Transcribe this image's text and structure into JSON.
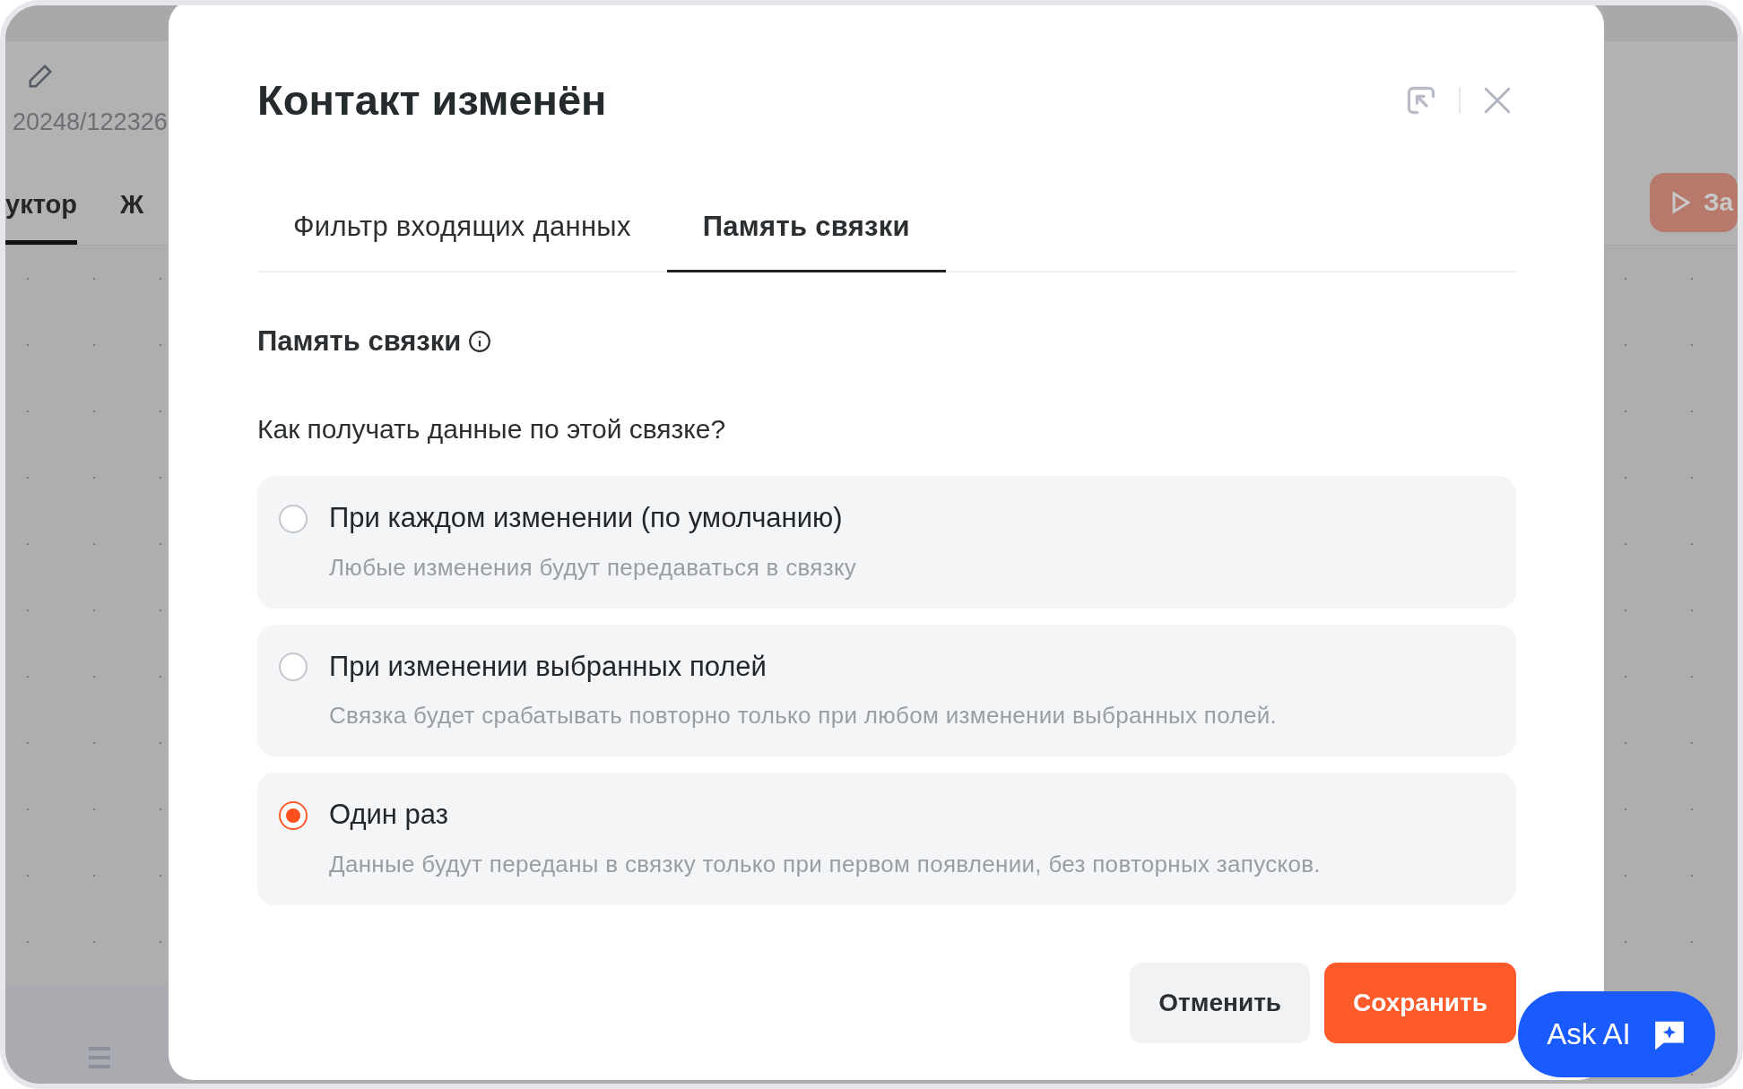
{
  "background_app": {
    "record_id": "20248/122326",
    "tabs": [
      {
        "label": "уктор",
        "selected": true
      },
      {
        "label": "Ж",
        "selected": false
      }
    ],
    "run_button": "За"
  },
  "dialog": {
    "title": "Контакт изменён",
    "tabs": [
      {
        "label": "Фильтр входящих данных",
        "selected": false
      },
      {
        "label": "Память связки",
        "selected": true
      }
    ],
    "section_title": "Память связки",
    "question": "Как получать данные по этой связке?",
    "options": [
      {
        "label": "При каждом изменении (по умолчанию)",
        "description": "Любые изменения будут передаваться в связку",
        "selected": false
      },
      {
        "label": "При изменении выбранных полей",
        "description": "Связка будет срабатывать повторно только при любом изменении выбранных полей.",
        "selected": false
      },
      {
        "label": "Один раз",
        "description": "Данные будут переданы в связку только при первом появлении, без повторных запусков.",
        "selected": true
      }
    ],
    "buttons": {
      "cancel": "Отменить",
      "save": "Сохранить"
    }
  },
  "ask_ai": "Ask AI"
}
